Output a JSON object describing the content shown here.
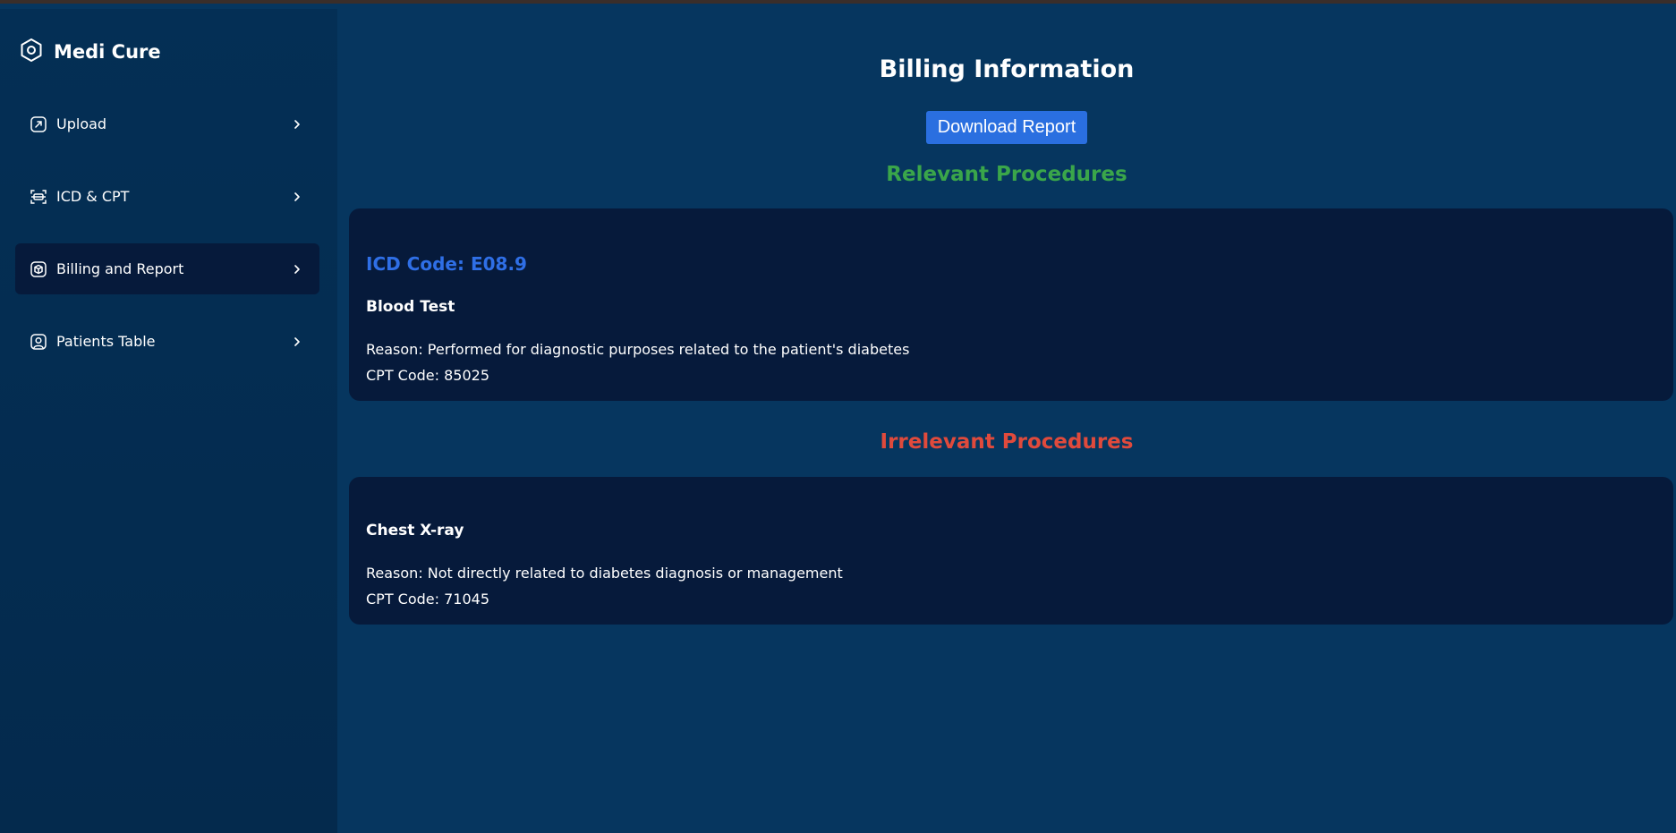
{
  "brand": {
    "name": "Medi Cure",
    "icon": "hexagon-logo-icon"
  },
  "sidebar": {
    "items": [
      {
        "label": "Upload",
        "icon": "upload-icon",
        "active": false
      },
      {
        "label": "ICD & CPT",
        "icon": "scan-icon",
        "active": false
      },
      {
        "label": "Billing and Report",
        "icon": "billing-icon",
        "active": true
      },
      {
        "label": "Patients Table",
        "icon": "user-icon",
        "active": false
      }
    ]
  },
  "main": {
    "title": "Billing Information",
    "download_label": "Download Report",
    "relevant": {
      "heading": "Relevant Procedures",
      "icd_code": "ICD Code: E08.9",
      "procedure": "Blood Test",
      "reason": "Reason: Performed for diagnostic purposes related to the patient's diabetes",
      "cpt": "CPT Code: 85025"
    },
    "irrelevant": {
      "heading": "Irrelevant Procedures",
      "procedure": "Chest X-ray",
      "reason": "Reason: Not directly related to diabetes diagnosis or management",
      "cpt": "CPT Code: 71045"
    }
  },
  "colors": {
    "background": "#06365f",
    "sidebar": "#042f55",
    "card": "#061a3b",
    "relevant": "#3aa64a",
    "irrelevant": "#e04a3c",
    "icd": "#2f6fe6",
    "button": "#2a6fe0"
  }
}
